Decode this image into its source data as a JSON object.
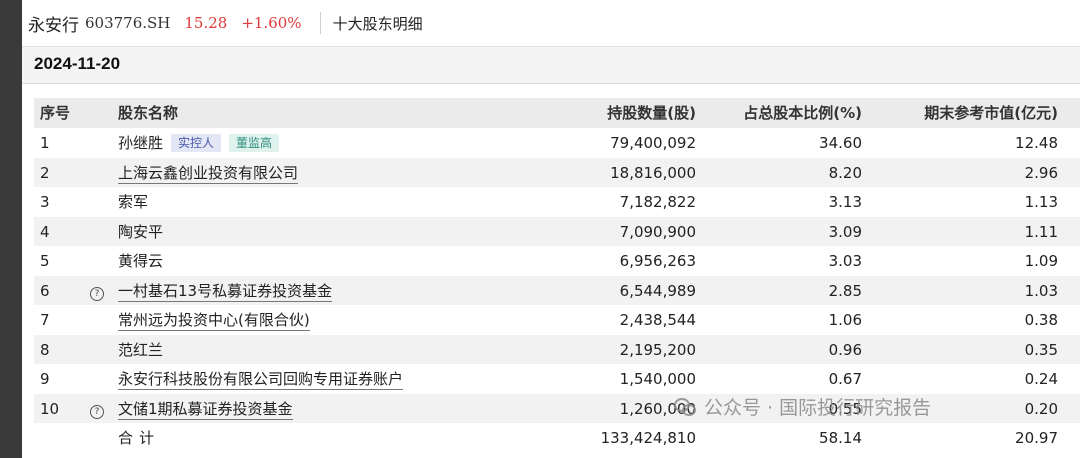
{
  "header": {
    "stock_name": "永安行",
    "stock_code": "603776.SH",
    "price": "15.28",
    "change": "+1.60%",
    "page_title": "十大股东明细"
  },
  "report_date": "2024-11-20",
  "table": {
    "columns": [
      "序号",
      "股东名称",
      "持股数量(股)",
      "占总股本比例(%)",
      "期末参考市值(亿元)"
    ],
    "rows": [
      {
        "idx": "1",
        "name": "孙继胜",
        "shares": "79,400,092",
        "pct": "34.60",
        "mv": "12.48"
      },
      {
        "idx": "2",
        "name": "上海云鑫创业投资有限公司",
        "shares": "18,816,000",
        "pct": "8.20",
        "mv": "2.96"
      },
      {
        "idx": "3",
        "name": "索军",
        "shares": "7,182,822",
        "pct": "3.13",
        "mv": "1.13"
      },
      {
        "idx": "4",
        "name": "陶安平",
        "shares": "7,090,900",
        "pct": "3.09",
        "mv": "1.11"
      },
      {
        "idx": "5",
        "name": "黄得云",
        "shares": "6,956,263",
        "pct": "3.03",
        "mv": "1.09"
      },
      {
        "idx": "6",
        "name": "一村基石13号私募证券投资基金",
        "shares": "6,544,989",
        "pct": "2.85",
        "mv": "1.03"
      },
      {
        "idx": "7",
        "name": "常州远为投资中心(有限合伙)",
        "shares": "2,438,544",
        "pct": "1.06",
        "mv": "0.38"
      },
      {
        "idx": "8",
        "name": "范红兰",
        "shares": "2,195,200",
        "pct": "0.96",
        "mv": "0.35"
      },
      {
        "idx": "9",
        "name": "永安行科技股份有限公司回购专用证券账户",
        "shares": "1,540,000",
        "pct": "0.67",
        "mv": "0.24"
      },
      {
        "idx": "10",
        "name": "文储1期私募证券投资基金",
        "shares": "1,260,000",
        "pct": "0.55",
        "mv": "0.20"
      }
    ],
    "tags": {
      "controller": "实控人",
      "director": "董监高"
    },
    "total": {
      "label": "合计",
      "shares": "133,424,810",
      "pct": "58.14",
      "mv": "20.97"
    }
  },
  "watermark": "公众号 · 国际投行研究报告",
  "icons": {
    "info": "help-circle-icon",
    "watermark_logo": "wechat-icon"
  }
}
